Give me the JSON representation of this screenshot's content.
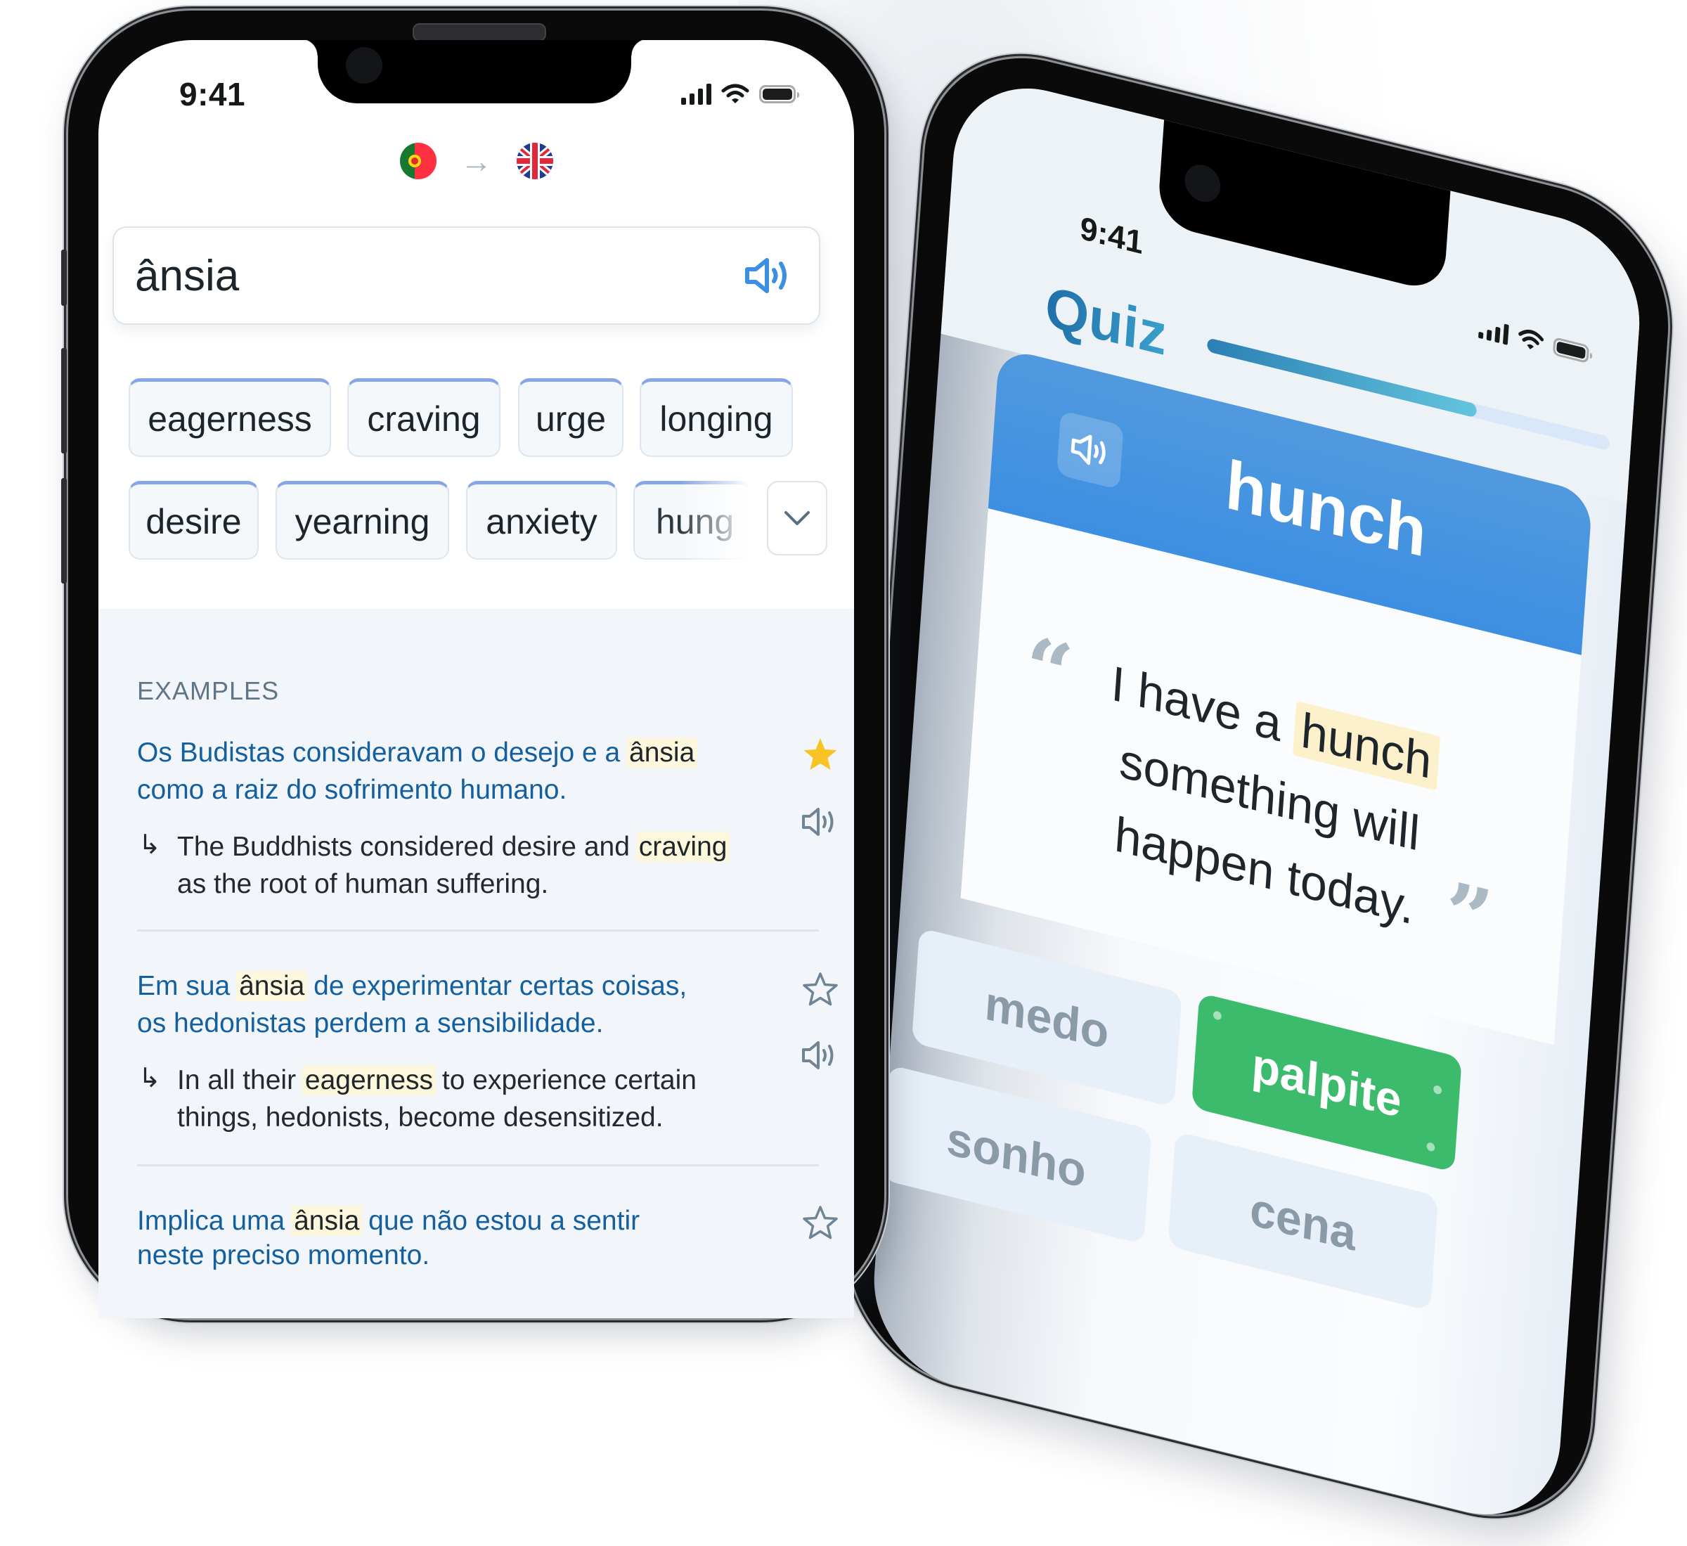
{
  "left_phone": {
    "status_bar": {
      "time": "9:41",
      "icons": [
        "cellular-signal-icon",
        "wifi-icon",
        "battery-icon"
      ]
    },
    "language_pair": {
      "from": "Portuguese",
      "from_flag": "portugal-flag-icon",
      "arrow": "→",
      "to": "English",
      "to_flag": "uk-flag-icon"
    },
    "search": {
      "value": "ânsia",
      "speaker_icon": "speaker-icon",
      "accent": "#3d8fe2"
    },
    "translations": [
      {
        "label": "eagerness"
      },
      {
        "label": "craving"
      },
      {
        "label": "urge"
      },
      {
        "label": "longing"
      },
      {
        "label": "desire"
      },
      {
        "label": "yearning"
      },
      {
        "label": "anxiety"
      },
      {
        "label": "hung"
      }
    ],
    "more_button_icon": "chevron-down-icon",
    "examples": {
      "title": "EXAMPLES",
      "items": [
        {
          "pt_before": "Os Budistas consideravam o desejo e a ",
          "pt_highlight": "ânsia",
          "pt_after": " como a raiz do sofrimento humano.",
          "en_before": "The Buddhists considered desire and ",
          "en_highlight": "craving",
          "en_after": " as the root of human suffering.",
          "starred": true
        },
        {
          "pt_before": "Em sua ",
          "pt_highlight": "ânsia",
          "pt_after": " de experimentar certas coisas, os hedonistas perdem a sensibilidade.",
          "en_before": "In all their ",
          "en_highlight": "eagerness",
          "en_after": " to experience certain things, hedonists, become desensitized.",
          "starred": false
        },
        {
          "pt_before": "Implica uma ",
          "pt_highlight": "ânsia",
          "pt_after": " que não estou a sentir neste preciso momento.",
          "starred": false
        }
      ]
    },
    "colors": {
      "pt_text": "#14609f",
      "highlight": "#fdf8dd",
      "star_active": "#f7c325",
      "star_inactive": "#6f8595"
    }
  },
  "right_phone": {
    "status_bar": {
      "time": "9:41"
    },
    "title": "Quiz",
    "progress": 0.67,
    "word": "hunch",
    "sentence_before": "I have a ",
    "sentence_highlight": "hunch",
    "sentence_line2": "something will",
    "sentence_line3": "happen today.",
    "open_quote": "“",
    "close_quote": "”",
    "answers": [
      {
        "label": "medo",
        "state": "default"
      },
      {
        "label": "palpite",
        "state": "correct"
      },
      {
        "label": "sonho",
        "state": "default"
      },
      {
        "label": "cena",
        "state": "default"
      }
    ],
    "colors": {
      "card": "#4394e0",
      "correct": "#3bbb6b",
      "answer_default": "#e7eff8"
    }
  }
}
